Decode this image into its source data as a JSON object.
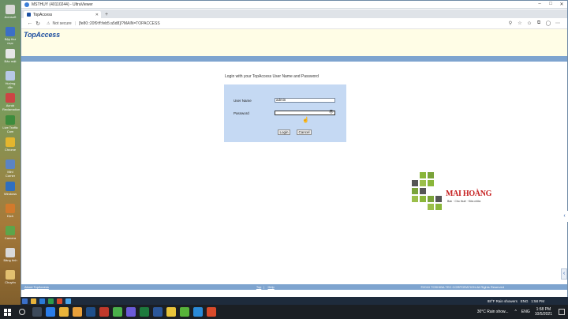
{
  "desktop": {
    "icons": [
      {
        "label": "Acrosoft",
        "color": "#d8d8d8"
      },
      {
        "label": "Bập thư mục",
        "color": "#3c6fc7"
      },
      {
        "label": "Bảo mật",
        "color": "#e6e6e6"
      },
      {
        "label": "Hướng dẫn",
        "color": "#b7c8e6"
      },
      {
        "label": "Acrob Reclamation",
        "color": "#c44"
      },
      {
        "label": "Live Traffic Cam",
        "color": "#3d8c3d"
      },
      {
        "label": "Chrome",
        "color": "#e4b62e"
      },
      {
        "label": "Mini Corner",
        "color": "#5b84c4"
      },
      {
        "label": "Windows",
        "color": "#2f6fbf"
      },
      {
        "label": "Dịch",
        "color": "#d27a2c"
      },
      {
        "label": "Camera",
        "color": "#5da54a"
      },
      {
        "label": "Bảng tính",
        "color": "#d9d9d9"
      },
      {
        "label": "Chuyên",
        "color": "#e2c070"
      }
    ]
  },
  "viewer": {
    "title": "MSTHUY (40110244) - UltraViewer"
  },
  "browser": {
    "tab_title": "TopAccess",
    "not_secure": "Not secure",
    "url": "[fe80::20f9:ff:feb5:a5d8]/?MAIN=TOPACCESS"
  },
  "page": {
    "logo": "TopAccess",
    "login_title": "Login with your TopAccess User Name and Password",
    "username_label": "User Name",
    "username_value": "admin",
    "password_label": "Password",
    "password_value": "",
    "login_button": "Login",
    "cancel_button": "Cancel",
    "footer_left": "About TopAccess",
    "footer_top": "Top",
    "footer_help": "Help",
    "footer_copyright": "©2010 TOSHIBA TEC CORPORATION All Rights Reserved"
  },
  "watermark": {
    "brand": "MAI HOÀNG",
    "tagline": "Bán · Cho thuê · Sửa chữa",
    "colors": [
      "#8ab63a",
      "#7aa33a",
      "#555555",
      "#9bbf4a"
    ]
  },
  "taskbar": {
    "weather": "30°C  Rain show...",
    "language": "ENG",
    "time": "1:58 PM",
    "date": "10/5/2021"
  },
  "remote_taskbar": {
    "weather": "88°F  Rain showers",
    "language": "ENG",
    "time": "1:58 PM"
  }
}
